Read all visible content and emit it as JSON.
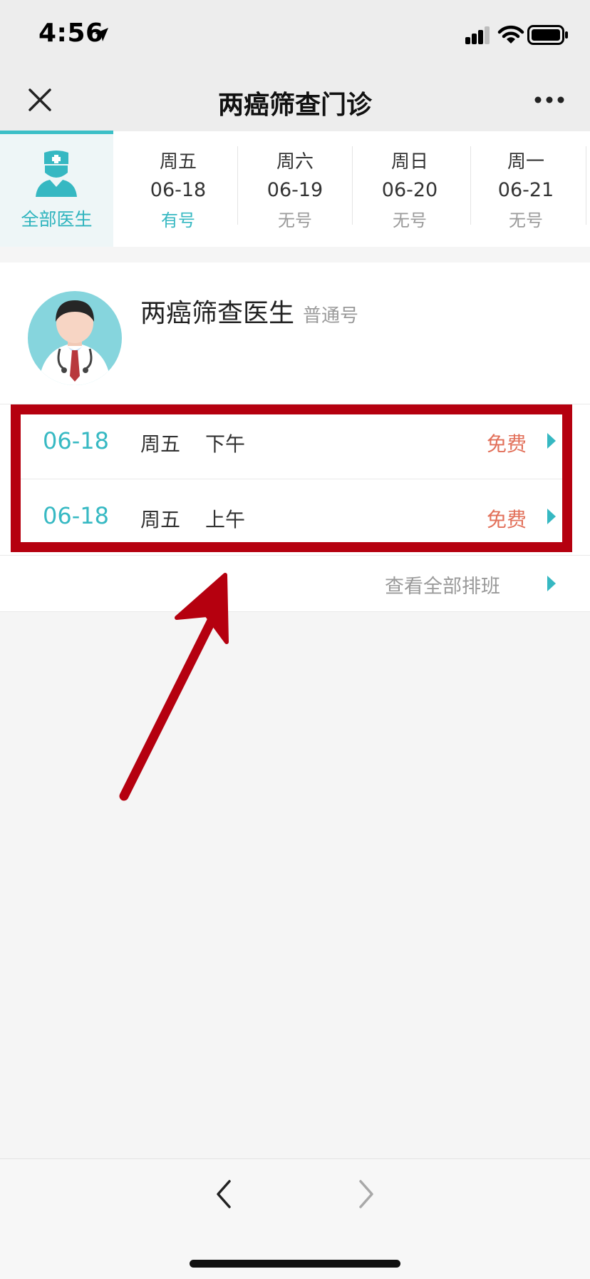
{
  "status_bar": {
    "time": "4:56"
  },
  "nav": {
    "title": "两癌筛查门诊"
  },
  "date_strip": {
    "all_doctors_label": "全部医生",
    "days": [
      {
        "week": "周五",
        "date": "06-18",
        "status": "有号",
        "available": true
      },
      {
        "week": "周六",
        "date": "06-19",
        "status": "无号",
        "available": false
      },
      {
        "week": "周日",
        "date": "06-20",
        "status": "无号",
        "available": false
      },
      {
        "week": "周一",
        "date": "06-21",
        "status": "无号",
        "available": false
      }
    ]
  },
  "doctor": {
    "name": "两癌筛查医生",
    "type": "普通号",
    "slots": [
      {
        "date": "06-18",
        "week": "周五",
        "period": "下午",
        "fee": "免费"
      },
      {
        "date": "06-18",
        "week": "周五",
        "period": "上午",
        "fee": "免费"
      }
    ],
    "view_all_label": "查看全部排班"
  },
  "colors": {
    "accent": "#36b8c2",
    "fee": "#e2705a",
    "annotation": "#b5000f"
  }
}
